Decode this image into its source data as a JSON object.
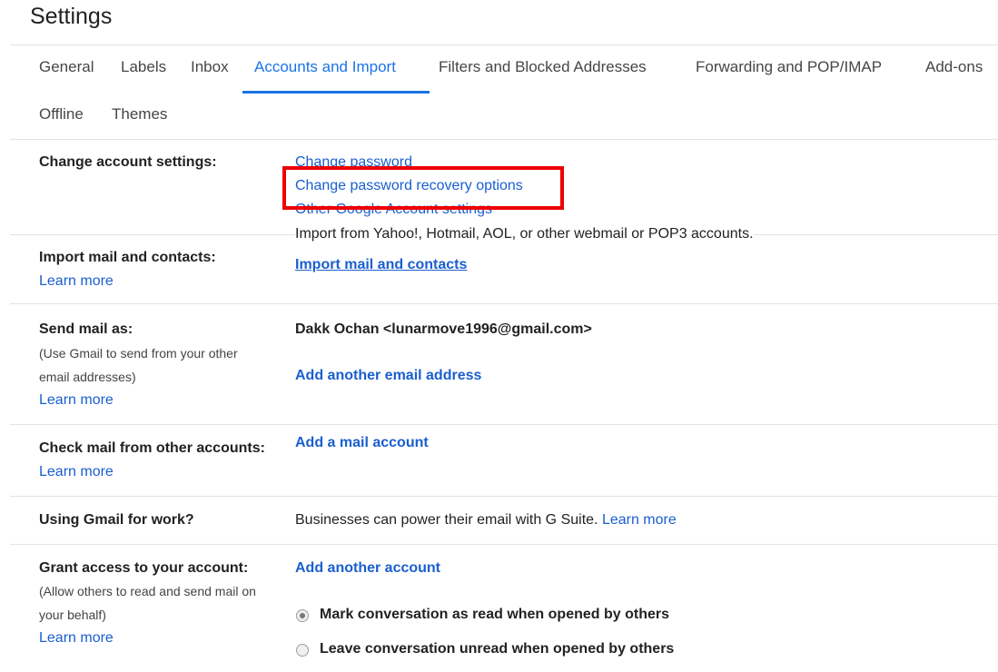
{
  "page": {
    "title": "Settings"
  },
  "tabs": [
    {
      "label": "General"
    },
    {
      "label": "Labels"
    },
    {
      "label": "Inbox"
    },
    {
      "label": "Accounts and Import"
    },
    {
      "label": "Filters and Blocked Addresses"
    },
    {
      "label": "Forwarding and POP/IMAP"
    },
    {
      "label": "Add-ons"
    },
    {
      "label": "Offline"
    },
    {
      "label": "Themes"
    }
  ],
  "active_tab": "Accounts and Import",
  "sections": {
    "change_account": {
      "label": "Change account settings:",
      "links": [
        "Change password",
        "Change password recovery options",
        "Other Google Account settings"
      ]
    },
    "import": {
      "label": "Import mail and contacts:",
      "learn_more": "Learn more",
      "description": "Import from Yahoo!, Hotmail, AOL, or other webmail or POP3 accounts.",
      "action": "Import mail and contacts"
    },
    "send_as": {
      "label": "Send mail as:",
      "sub_line1": "(Use Gmail to send from your other",
      "sub_line2": "email addresses)",
      "learn_more": "Learn more",
      "address": "Dakk Ochan <lunarmove1996@gmail.com>",
      "action": "Add another email address"
    },
    "check_mail": {
      "label": "Check mail from other accounts:",
      "learn_more": "Learn more",
      "action": "Add a mail account"
    },
    "work": {
      "label": "Using Gmail for work?",
      "text": "Businesses can power their email with G Suite.",
      "link": "Learn more"
    },
    "grant": {
      "label": "Grant access to your account:",
      "sub_line1": "(Allow others to read and send mail on",
      "sub_line2": "your behalf)",
      "learn_more": "Learn more",
      "action": "Add another account",
      "options": [
        {
          "label": "Mark conversation as read when opened by others",
          "selected": true
        },
        {
          "label": "Leave conversation unread when opened by others",
          "selected": false
        }
      ]
    }
  },
  "colors": {
    "link": "#1a5fcf",
    "active_tab": "#1a73e8",
    "highlight_box": "#ee0000"
  }
}
